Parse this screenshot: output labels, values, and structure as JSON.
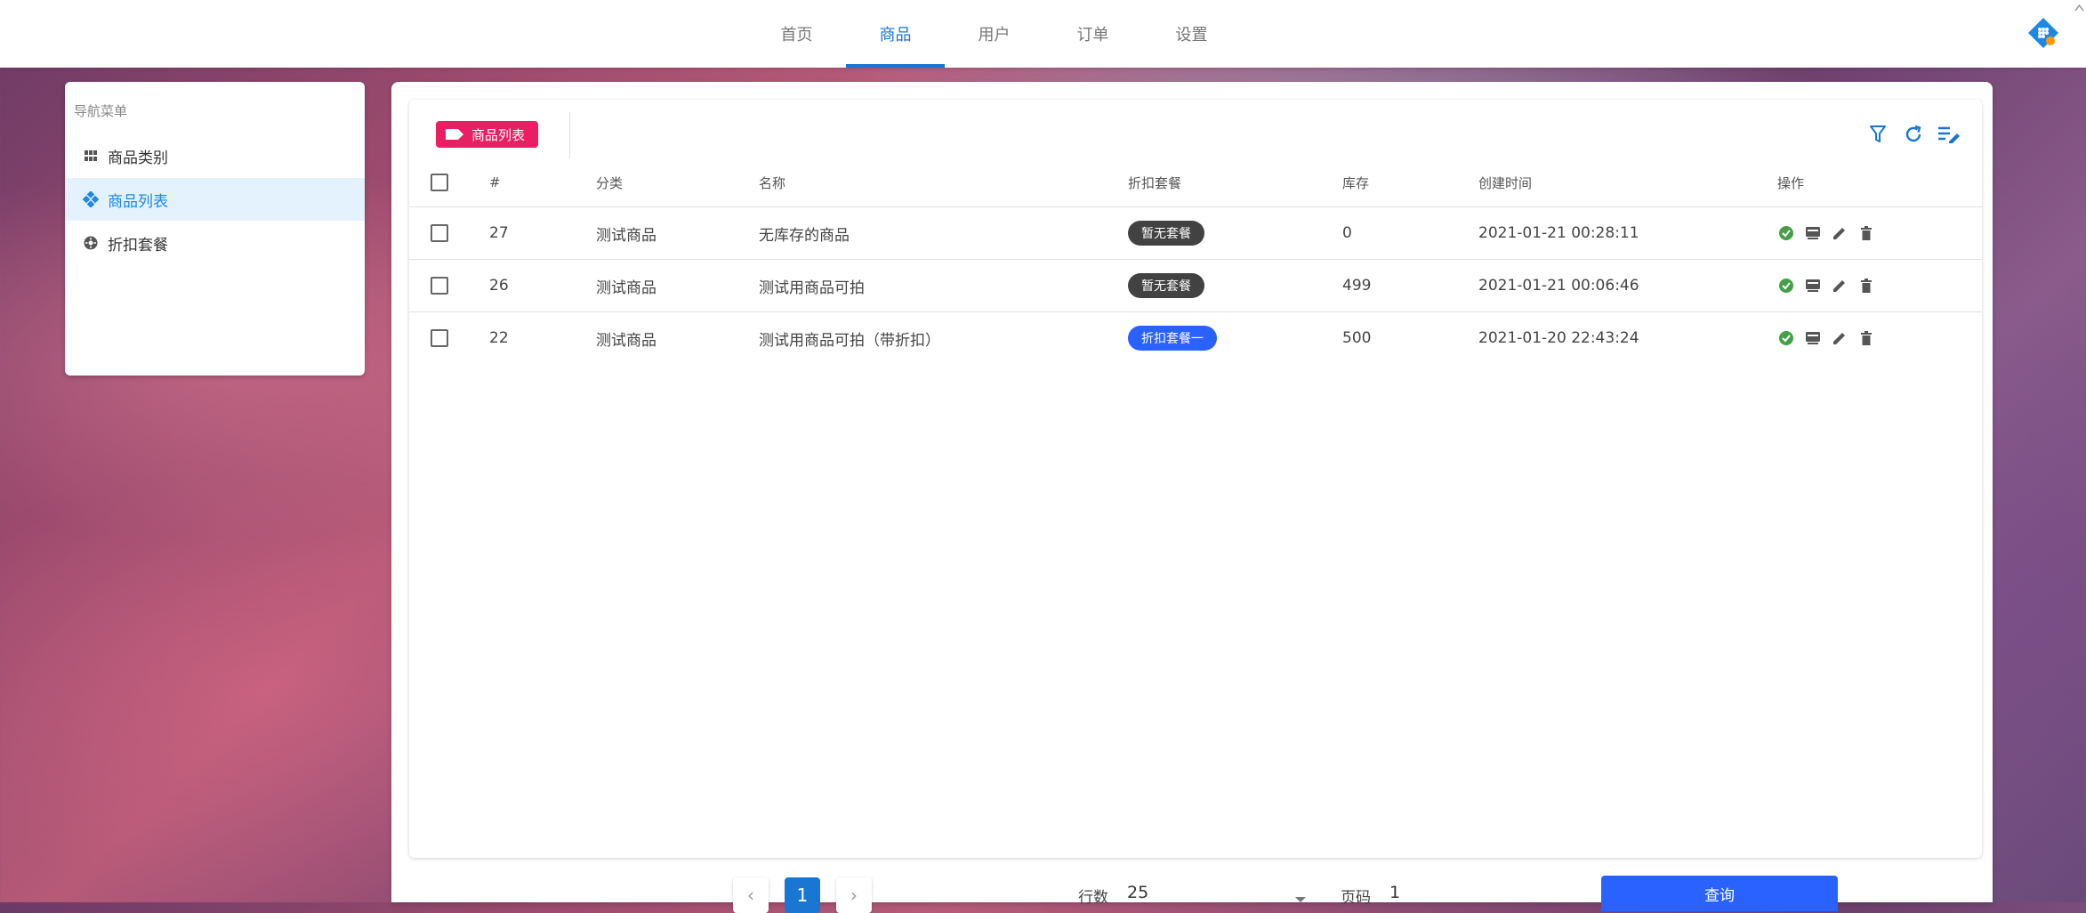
{
  "topnav": {
    "tabs": [
      "首页",
      "商品",
      "用户",
      "订单",
      "设置"
    ],
    "active_index": 1
  },
  "sidebar": {
    "title": "导航菜单",
    "items": [
      {
        "label": "商品类别",
        "icon": "grid-icon"
      },
      {
        "label": "商品列表",
        "icon": "diamond-cluster-icon",
        "active": true
      },
      {
        "label": "折扣套餐",
        "icon": "gear-badge-icon"
      }
    ]
  },
  "panel": {
    "title_chip": "商品列表",
    "tools": [
      "filter-icon",
      "refresh-icon",
      "edit-list-icon"
    ]
  },
  "table": {
    "headers": {
      "num": "#",
      "category": "分类",
      "name": "名称",
      "package": "折扣套餐",
      "stock": "库存",
      "created": "创建时间",
      "actions": "操作"
    },
    "rows": [
      {
        "id": "27",
        "category": "测试商品",
        "name": "无库存的商品",
        "package": "暂无套餐",
        "package_color": "#424242",
        "stock": "0",
        "created": "2021-01-21 00:28:11"
      },
      {
        "id": "26",
        "category": "测试商品",
        "name": "测试用商品可拍",
        "package": "暂无套餐",
        "package_color": "#424242",
        "stock": "499",
        "created": "2021-01-21 00:06:46"
      },
      {
        "id": "22",
        "category": "测试商品",
        "name": "测试用商品可拍（带折扣）",
        "package": "折扣套餐一",
        "package_color": "#2962ff",
        "stock": "500",
        "created": "2021-01-20 22:43:24"
      }
    ]
  },
  "footer": {
    "prev": "‹",
    "current_page": "1",
    "next": "›",
    "rows_label": "行数",
    "rows_value": "25",
    "page_label": "页码",
    "page_value": "1",
    "query_label": "查询"
  },
  "colors": {
    "accent": "#1976d2",
    "chip": "#e91e63",
    "query": "#2962ff"
  }
}
